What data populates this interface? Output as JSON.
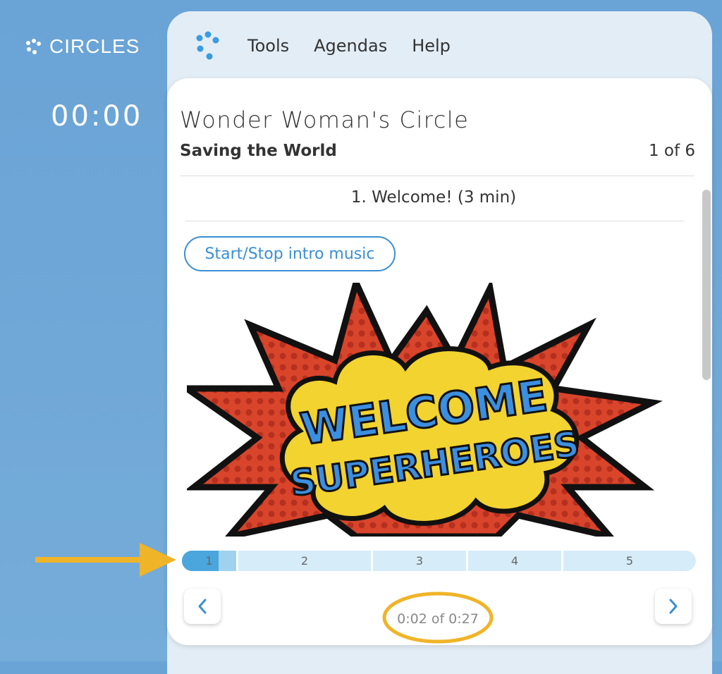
{
  "brand": {
    "name": "CIRCLES"
  },
  "timer": "00:00",
  "nav": {
    "menu": [
      "Tools",
      "Agendas",
      "Help"
    ]
  },
  "card": {
    "circle_title": "Wonder Woman's Circle",
    "agenda_title": "Saving the World",
    "page_count": "1 of 6",
    "item_title": "1. Welcome! (3 min)",
    "music_button": "Start/Stop intro music",
    "image_text": [
      "WELCOME",
      "SUPERHEROES"
    ],
    "progress": {
      "segments": [
        "1",
        "2",
        "3",
        "4",
        "5"
      ],
      "current_fill": 0.68
    },
    "playtime": "0:02 of 0:27"
  },
  "colors": {
    "background": "#6aa3d6",
    "accent": "#3a8fd1",
    "annotation": "#f0b429"
  },
  "icons": [
    "circles-logo-icon",
    "chevron-left-icon",
    "chevron-right-icon",
    "annotation-arrow-icon"
  ]
}
